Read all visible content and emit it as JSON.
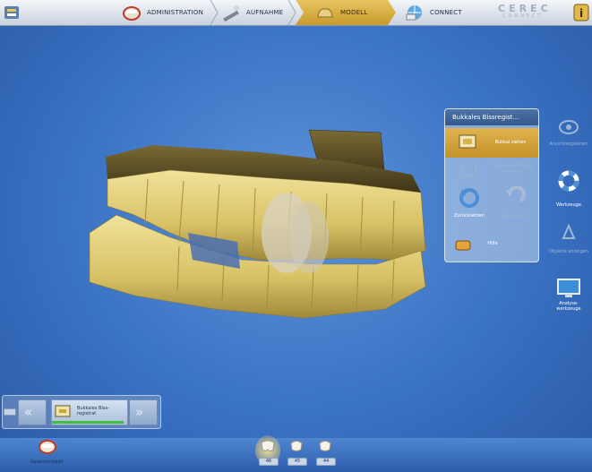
{
  "navigation": {
    "tabs": [
      {
        "label": "ADMINISTRATION",
        "active": false
      },
      {
        "label": "AUFNAHME",
        "active": false
      },
      {
        "label": "MODELL",
        "active": true
      },
      {
        "label": "CONNECT",
        "active": false
      }
    ],
    "logo_line1": "CEREC",
    "logo_line2": "CONNECT"
  },
  "tool_panel": {
    "title": "Bukkales Bissregist...",
    "items": {
      "primary": "Bukkal ziehen",
      "secondary": "Bukkalen Abdruck drehen",
      "reset": "Zurücksetzen",
      "undo": "Rückgängig",
      "help": "Hilfe"
    }
  },
  "right_sidebar": {
    "view_options": "Ansichtsoptionen",
    "tools": "Werkzeuge",
    "select_objects": "Objekte anzeigen",
    "analysis_tools": "Analyse-werkzeuge"
  },
  "workflow": {
    "step_label": "Bukkales Biss-registrat",
    "progress": 1.0
  },
  "bottom": {
    "overview_label": "Gesamtmodell",
    "teeth": [
      "46",
      "45",
      "44"
    ],
    "selected_tooth": "46"
  },
  "colors": {
    "accent_gold": "#d9a940",
    "background_blue": "#3a72c4",
    "progress_green": "#3fbf3a"
  }
}
